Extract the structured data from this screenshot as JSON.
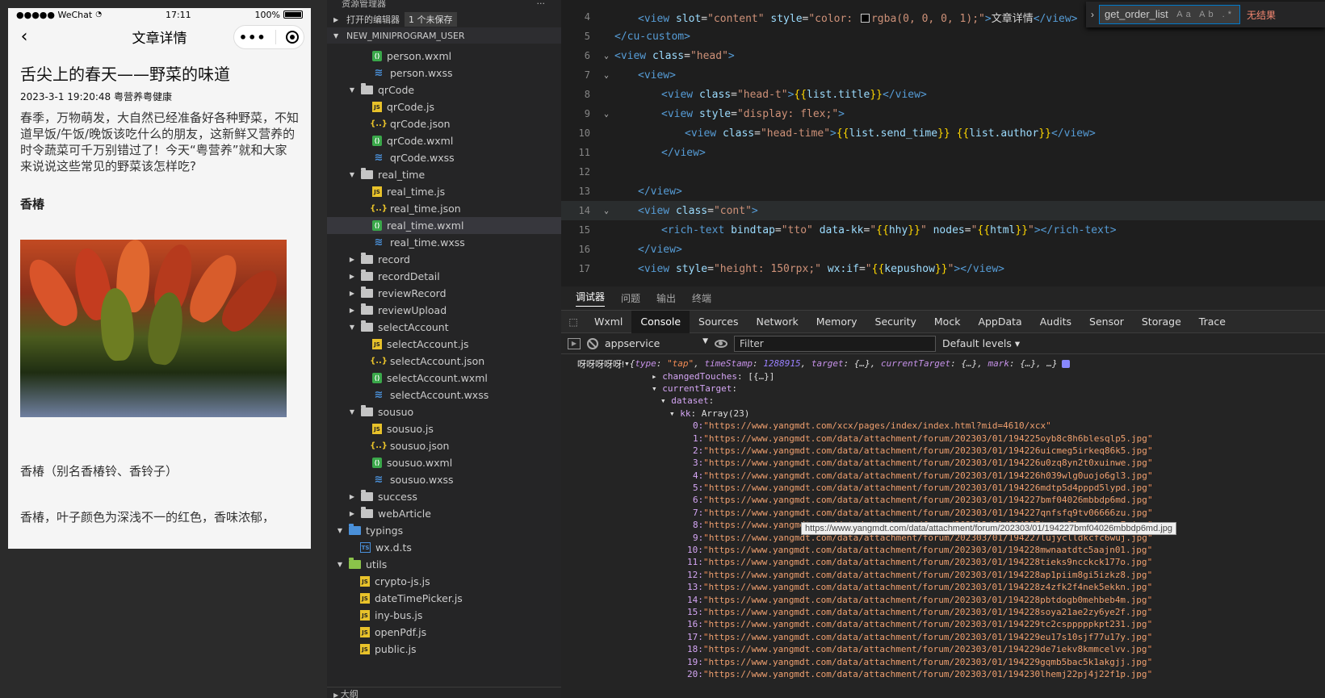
{
  "phone": {
    "status": {
      "carrier": "●●●●● WeChat",
      "wifi": "wifi-icon",
      "time": "17:11",
      "battery": "100%",
      "battery_level": 1.0
    },
    "nav_title": "文章详情",
    "capsule_dots": "•••",
    "article": {
      "title": "舌尖上的春天——野菜的味道",
      "meta": "2023-3-1 19:20:48 粤营养粤健康",
      "intro": "春季，万物萌发，大自然已经准备好各种野菜，不知道早饭/午饭/晚饭该吃什么的朋友，这新鲜又营养的时令蔬菜可千万别错过了！今天“粤营养”就和大家来说说这些常见的野菜该怎样吃?",
      "heading": "香椿",
      "para1": "香椿（别名香椿铃、香铃子）",
      "para2": "香椿，叶子颜色为深浅不一的红色，香味浓郁，"
    }
  },
  "explorer": {
    "header": "资源管理器",
    "header_more": "···",
    "open_editors": "打开的编辑器",
    "unsaved_badge": "1 个未保存",
    "project": "NEW_MINIPROGRAM_USER",
    "partial_top": "",
    "tree": [
      {
        "label": "person.wxml",
        "type": "wxml",
        "depth": 3
      },
      {
        "label": "person.wxss",
        "type": "wxss",
        "depth": 3
      },
      {
        "label": "qrCode",
        "type": "folder-open",
        "depth": 2
      },
      {
        "label": "qrCode.js",
        "type": "js",
        "depth": 3
      },
      {
        "label": "qrCode.json",
        "type": "json",
        "depth": 3
      },
      {
        "label": "qrCode.wxml",
        "type": "wxml",
        "depth": 3
      },
      {
        "label": "qrCode.wxss",
        "type": "wxss",
        "depth": 3
      },
      {
        "label": "real_time",
        "type": "folder-open",
        "depth": 2
      },
      {
        "label": "real_time.js",
        "type": "js",
        "depth": 3
      },
      {
        "label": "real_time.json",
        "type": "json",
        "depth": 3
      },
      {
        "label": "real_time.wxml",
        "type": "wxml",
        "depth": 3,
        "selected": true
      },
      {
        "label": "real_time.wxss",
        "type": "wxss",
        "depth": 3
      },
      {
        "label": "record",
        "type": "folder",
        "depth": 2
      },
      {
        "label": "recordDetail",
        "type": "folder",
        "depth": 2
      },
      {
        "label": "reviewRecord",
        "type": "folder",
        "depth": 2
      },
      {
        "label": "reviewUpload",
        "type": "folder",
        "depth": 2
      },
      {
        "label": "selectAccount",
        "type": "folder-open",
        "depth": 2
      },
      {
        "label": "selectAccount.js",
        "type": "js",
        "depth": 3
      },
      {
        "label": "selectAccount.json",
        "type": "json",
        "depth": 3
      },
      {
        "label": "selectAccount.wxml",
        "type": "wxml",
        "depth": 3
      },
      {
        "label": "selectAccount.wxss",
        "type": "wxss",
        "depth": 3
      },
      {
        "label": "sousuo",
        "type": "folder-open",
        "depth": 2
      },
      {
        "label": "sousuo.js",
        "type": "js",
        "depth": 3
      },
      {
        "label": "sousuo.json",
        "type": "json",
        "depth": 3
      },
      {
        "label": "sousuo.wxml",
        "type": "wxml",
        "depth": 3
      },
      {
        "label": "sousuo.wxss",
        "type": "wxss",
        "depth": 3
      },
      {
        "label": "success",
        "type": "folder",
        "depth": 2
      },
      {
        "label": "webArticle",
        "type": "folder",
        "depth": 2
      },
      {
        "label": "typings",
        "type": "folder-open-blue",
        "depth": 1
      },
      {
        "label": "wx.d.ts",
        "type": "ts",
        "depth": 2
      },
      {
        "label": "utils",
        "type": "folder-open-green",
        "depth": 1
      },
      {
        "label": "crypto-js.js",
        "type": "js",
        "depth": 2
      },
      {
        "label": "dateTimePicker.js",
        "type": "js",
        "depth": 2
      },
      {
        "label": "iny-bus.js",
        "type": "js",
        "depth": 2
      },
      {
        "label": "openPdf.js",
        "type": "js",
        "depth": 2
      },
      {
        "label": "public.js",
        "type": "js",
        "depth": 2
      }
    ],
    "outline": "大纲"
  },
  "editor": {
    "lines": [
      {
        "n": "4",
        "fold": "",
        "indent": 1,
        "hl": false
      },
      {
        "n": "5",
        "fold": "",
        "indent": 0,
        "hl": false
      },
      {
        "n": "6",
        "fold": "⌄",
        "indent": 0,
        "hl": false
      },
      {
        "n": "7",
        "fold": "⌄",
        "indent": 1,
        "hl": false
      },
      {
        "n": "8",
        "fold": "",
        "indent": 2,
        "hl": false
      },
      {
        "n": "9",
        "fold": "⌄",
        "indent": 2,
        "hl": false
      },
      {
        "n": "10",
        "fold": "",
        "indent": 3,
        "hl": false
      },
      {
        "n": "11",
        "fold": "",
        "indent": 2,
        "hl": false
      },
      {
        "n": "12",
        "fold": "",
        "indent": 0,
        "hl": false
      },
      {
        "n": "13",
        "fold": "",
        "indent": 1,
        "hl": false
      },
      {
        "n": "14",
        "fold": "⌄",
        "indent": 1,
        "hl": true
      },
      {
        "n": "15",
        "fold": "",
        "indent": 2,
        "hl": false
      },
      {
        "n": "16",
        "fold": "",
        "indent": 1,
        "hl": false
      },
      {
        "n": "17",
        "fold": "",
        "indent": 1,
        "hl": false
      }
    ],
    "line4": {
      "open": "<view",
      "attr1": "slot",
      "val1": "\"content\"",
      "attr2": "style",
      "val2a": "\"color: ",
      "val2b": "rgba(0, 0, 0, 1);\"",
      "close": ">",
      "text": "文章详情",
      "end": "</view>"
    },
    "line5": "</cu-custom>",
    "line6": {
      "open": "<view",
      "attr": "class",
      "val": "\"head\"",
      "close": ">"
    },
    "line7": "<view>",
    "line8": {
      "open": "<view",
      "attr": "class",
      "val": "\"head-t\"",
      "close": ">",
      "b1": "{{",
      "var": "list.title",
      "b2": "}}",
      "end": "</view>"
    },
    "line9": {
      "open": "<view",
      "attr": "style",
      "val": "\"display: flex;\"",
      "close": ">"
    },
    "line10": {
      "open": "<view",
      "attr": "class",
      "val": "\"head-time\"",
      "close": ">",
      "b1": "{{",
      "var1": "list.send_time",
      "b2": "}}",
      "b3": "{{",
      "var2": "list.author",
      "b4": "}}",
      "end": "</view>"
    },
    "line11": "</view>",
    "line13": "</view>",
    "line14": {
      "open": "<view",
      "attr": "class",
      "val": "\"cont\"",
      "close": ">"
    },
    "line15": {
      "open": "<rich-text",
      "attr1": "bindtap",
      "val1": "\"tto\"",
      "attr2": "data-kk",
      "v2a": "\"",
      "b1": "{{",
      "var1": "hhy",
      "b2": "}}",
      "v2b": "\"",
      "attr3": "nodes",
      "v3a": "\"",
      "b3": "{{",
      "var2": "html",
      "b4": "}}",
      "v3b": "\"",
      "close": "></rich-text>"
    },
    "line16": "</view>",
    "line17": {
      "open": "<view",
      "attr1": "style",
      "val1": "\"height: 150rpx;\"",
      "attr2": "wx:if",
      "v2a": "\"",
      "b1": "{{",
      "var": "kepushow",
      "b2": "}}",
      "v2b": "\"",
      "close": "></view>"
    },
    "find": {
      "query": "get_order_list",
      "options": "Aa Ab .*",
      "result": "无结果"
    }
  },
  "debugger": {
    "top_tabs": [
      "调试器",
      "问题",
      "输出",
      "终端"
    ],
    "dev_tabs": [
      "Wxml",
      "Console",
      "Sources",
      "Network",
      "Memory",
      "Security",
      "Mock",
      "AppData",
      "Audits",
      "Sensor",
      "Storage",
      "Trace"
    ],
    "active_dev_tab": "Console",
    "context": "appservice",
    "filter_placeholder": "Filter",
    "levels": "Default levels ▾",
    "log_label": "呀呀呀呀呀!",
    "log_summary": {
      "k1": "type",
      "v1": "\"tap\"",
      "k2": "timeStamp",
      "v2": "1288915",
      "k3": "target",
      "v3": "{…}",
      "k4": "currentTarget",
      "v4": "{…}",
      "k5": "mark",
      "v5": "{…}",
      "tail": "…}"
    },
    "changed_touches": {
      "key": "changedTouches",
      "val": "[{…}]"
    },
    "current_target": "currentTarget",
    "dataset": "dataset",
    "kk": {
      "key": "kk",
      "val": "Array(23)"
    },
    "urls": [
      "https://www.yangmdt.com/xcx/pages/index/index.html?mid=4610/xcx",
      "https://www.yangmdt.com/data/attachment/forum/202303/01/194225oyb8c8h6blesqlp5.jpg",
      "https://www.yangmdt.com/data/attachment/forum/202303/01/194226uicmeg5irkeq86k5.jpg",
      "https://www.yangmdt.com/data/attachment/forum/202303/01/194226u0zq8yn2t0xuinwe.jpg",
      "https://www.yangmdt.com/data/attachment/forum/202303/01/194226h039wlg0uojo6gl3.jpg",
      "https://www.yangmdt.com/data/attachment/forum/202303/01/194226mdtp5d4pppd5lypd.jpg",
      "https://www.yangmdt.com/data/attachment/forum/202303/01/194227bmf04026mbbdp6md.jpg",
      "https://www.yangmdt.com/data/attachment/forum/202303/01/194227qnfsfq9tv06666zu.jpg",
      "https://www.yangmdt.com/data/attachment/forum/202303/01/194227tzwmt22xxojsxtw7.jpg",
      "https://www.yangmdt.com/data/attachment/forum/202303/01/194227lujyclldkcfc6wuj.jpg",
      "https://www.yangmdt.com/data/attachment/forum/202303/01/194228mwnaatdtc5aajn01.jpg",
      "https://www.yangmdt.com/data/attachment/forum/202303/01/194228tieks9ncckck177o.jpg",
      "https://www.yangmdt.com/data/attachment/forum/202303/01/194228ap1piim8gi5izkz8.jpg",
      "https://www.yangmdt.com/data/attachment/forum/202303/01/194228z4zfk2f4nek5ekkn.jpg",
      "https://www.yangmdt.com/data/attachment/forum/202303/01/194228pbtdogb0mehbeb4m.jpg",
      "https://www.yangmdt.com/data/attachment/forum/202303/01/194228soya21ae2zy6ye2f.jpg",
      "https://www.yangmdt.com/data/attachment/forum/202303/01/194229tc2cspppppkpt231.jpg",
      "https://www.yangmdt.com/data/attachment/forum/202303/01/194229eu17s10sjf77u17y.jpg",
      "https://www.yangmdt.com/data/attachment/forum/202303/01/194229de7iekv8kmmcelvv.jpg",
      "https://www.yangmdt.com/data/attachment/forum/202303/01/194229gqmb5bac5k1akgjj.jpg",
      "https://www.yangmdt.com/data/attachment/forum/202303/01/194230lhemj22pj4j22f1p.jpg"
    ],
    "tooltip": "https://www.yangmdt.com/data/attachment/forum/202303/01/194227bmf04026mbbdp6md.jpg"
  }
}
